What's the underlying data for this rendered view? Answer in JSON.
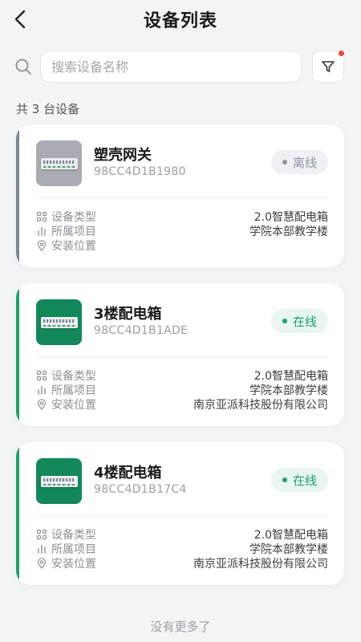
{
  "header": {
    "title": "设备列表"
  },
  "search": {
    "placeholder": "搜索设备名称"
  },
  "summary": {
    "count_text": "共 3 台设备"
  },
  "labels": {
    "type": "设备类型",
    "project": "所属项目",
    "location": "安装位置"
  },
  "colors": {
    "online": "#1ba26b",
    "online_bg": "#e8f6ef",
    "offline": "#8f96a3",
    "offline_bg": "#eef0f3",
    "offline_bar": "#7d8593",
    "online_bar": "#1ba26b",
    "thumb_offline_bg": "#a9acb2",
    "thumb_online_bg": "#12885a",
    "filter_dot": "#e84c3d"
  },
  "devices": [
    {
      "name": "塑壳网关",
      "code": "98CC4D1B1980",
      "status": "离线",
      "online": false,
      "type": "2.0智慧配电箱",
      "project": "学院本部教学楼",
      "location": ""
    },
    {
      "name": "3楼配电箱",
      "code": "98CC4D1B1ADE",
      "status": "在线",
      "online": true,
      "type": "2.0智慧配电箱",
      "project": "学院本部教学楼",
      "location": "南京亚派科技股份有限公司"
    },
    {
      "name": "4楼配电箱",
      "code": "98CC4D1B17C4",
      "status": "在线",
      "online": true,
      "type": "2.0智慧配电箱",
      "project": "学院本部教学楼",
      "location": "南京亚派科技股份有限公司"
    }
  ],
  "footer": {
    "text": "没有更多了"
  }
}
